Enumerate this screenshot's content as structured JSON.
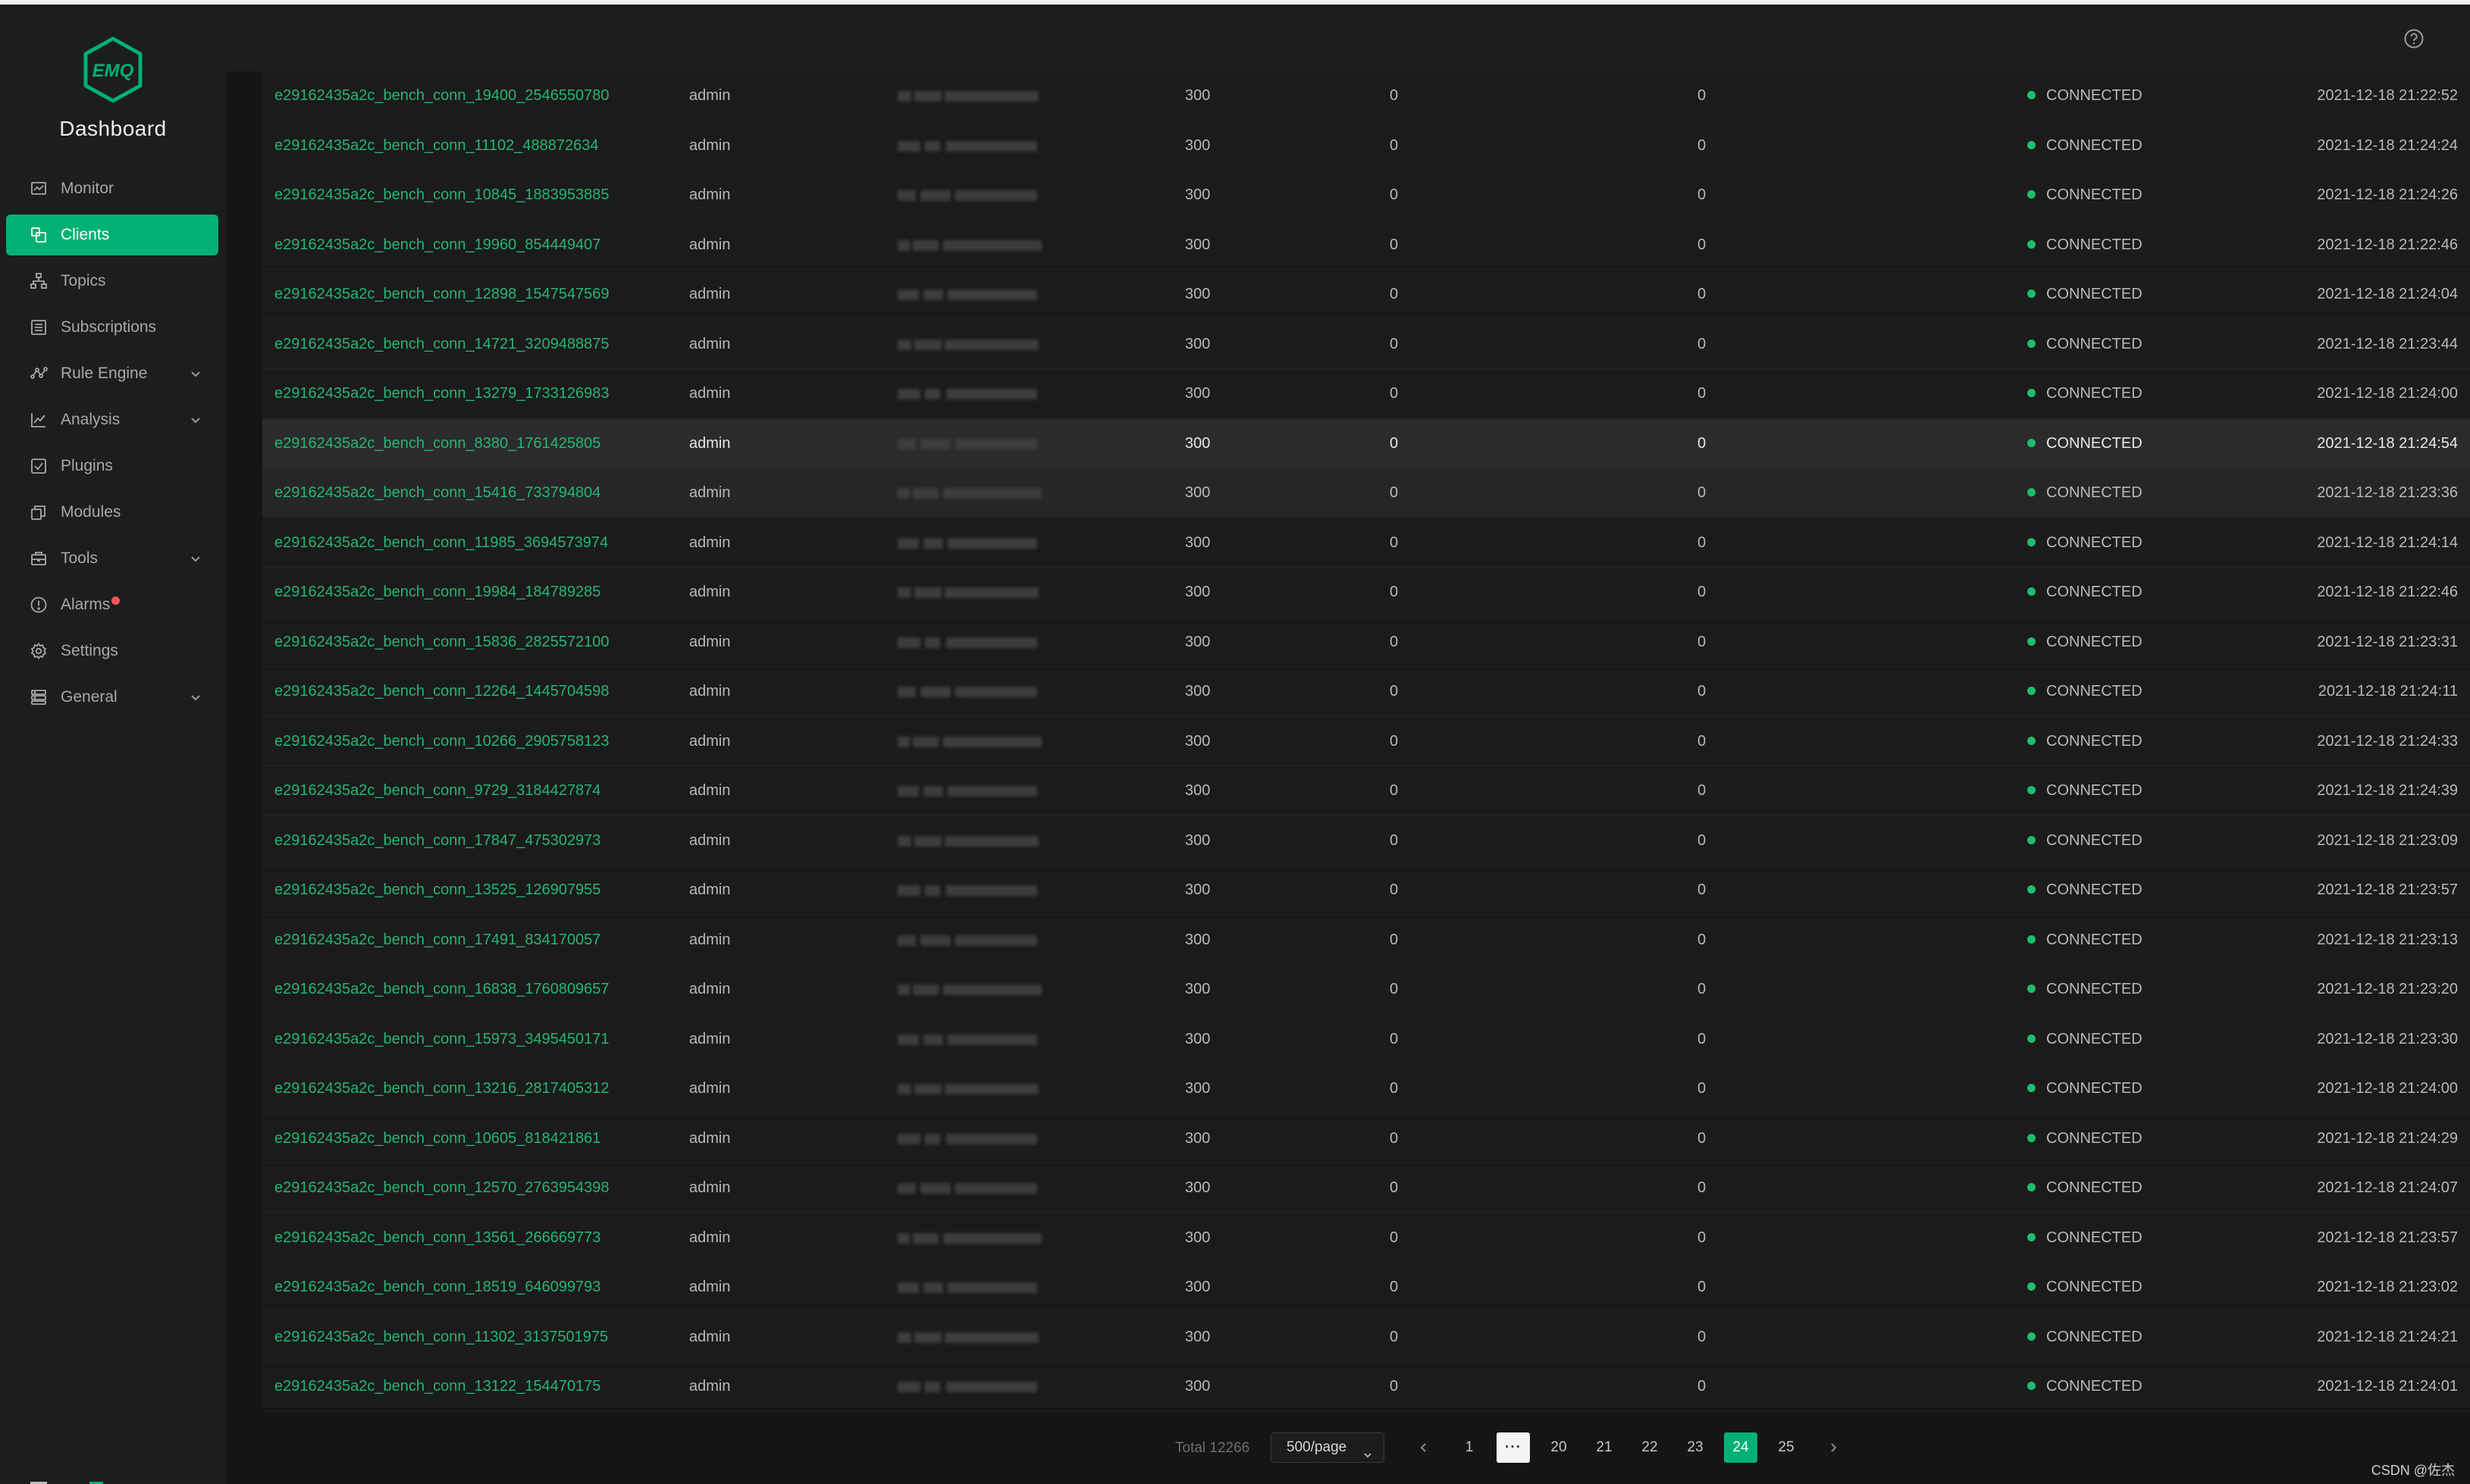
{
  "app": {
    "title": "Dashboard",
    "logo_text": "EMQ",
    "accent": "#00b173"
  },
  "sidebar": {
    "items": [
      {
        "key": "monitor",
        "label": "Monitor",
        "icon": "monitor-icon",
        "active": false,
        "expandable": false
      },
      {
        "key": "clients",
        "label": "Clients",
        "icon": "clients-icon",
        "active": true,
        "expandable": false
      },
      {
        "key": "topics",
        "label": "Topics",
        "icon": "topics-icon",
        "active": false,
        "expandable": false
      },
      {
        "key": "subscriptions",
        "label": "Subscriptions",
        "icon": "subscriptions-icon",
        "active": false,
        "expandable": false
      },
      {
        "key": "rule-engine",
        "label": "Rule Engine",
        "icon": "rule-engine-icon",
        "active": false,
        "expandable": true
      },
      {
        "key": "analysis",
        "label": "Analysis",
        "icon": "analysis-icon",
        "active": false,
        "expandable": true
      },
      {
        "key": "plugins",
        "label": "Plugins",
        "icon": "plugins-icon",
        "active": false,
        "expandable": false
      },
      {
        "key": "modules",
        "label": "Modules",
        "icon": "modules-icon",
        "active": false,
        "expandable": false
      },
      {
        "key": "tools",
        "label": "Tools",
        "icon": "tools-icon",
        "active": false,
        "expandable": true
      },
      {
        "key": "alarms",
        "label": "Alarms",
        "icon": "alarms-icon",
        "active": false,
        "expandable": false,
        "badge_dot": true
      },
      {
        "key": "settings",
        "label": "Settings",
        "icon": "settings-icon",
        "active": false,
        "expandable": false
      },
      {
        "key": "general",
        "label": "General",
        "icon": "general-icon",
        "active": false,
        "expandable": true
      }
    ]
  },
  "header": {
    "help_icon": "help-icon"
  },
  "table": {
    "status_color": "#1fbc6d",
    "rows": [
      {
        "client_id": "e29162435a2c_bench_conn_19400_2546550780",
        "username": "admin",
        "keepalive": "300",
        "q1": "0",
        "q2": "0",
        "status": "CONNECTED",
        "time": "2021-12-18 21:22:52"
      },
      {
        "client_id": "e29162435a2c_bench_conn_11102_488872634",
        "username": "admin",
        "keepalive": "300",
        "q1": "0",
        "q2": "0",
        "status": "CONNECTED",
        "time": "2021-12-18 21:24:24"
      },
      {
        "client_id": "e29162435a2c_bench_conn_10845_1883953885",
        "username": "admin",
        "keepalive": "300",
        "q1": "0",
        "q2": "0",
        "status": "CONNECTED",
        "time": "2021-12-18 21:24:26"
      },
      {
        "client_id": "e29162435a2c_bench_conn_19960_854449407",
        "username": "admin",
        "keepalive": "300",
        "q1": "0",
        "q2": "0",
        "status": "CONNECTED",
        "time": "2021-12-18 21:22:46"
      },
      {
        "client_id": "e29162435a2c_bench_conn_12898_1547547569",
        "username": "admin",
        "keepalive": "300",
        "q1": "0",
        "q2": "0",
        "status": "CONNECTED",
        "time": "2021-12-18 21:24:04"
      },
      {
        "client_id": "e29162435a2c_bench_conn_14721_3209488875",
        "username": "admin",
        "keepalive": "300",
        "q1": "0",
        "q2": "0",
        "status": "CONNECTED",
        "time": "2021-12-18 21:23:44"
      },
      {
        "client_id": "e29162435a2c_bench_conn_13279_1733126983",
        "username": "admin",
        "keepalive": "300",
        "q1": "0",
        "q2": "0",
        "status": "CONNECTED",
        "time": "2021-12-18 21:24:00"
      },
      {
        "client_id": "e29162435a2c_bench_conn_8380_1761425805",
        "username": "admin",
        "keepalive": "300",
        "q1": "0",
        "q2": "0",
        "status": "CONNECTED",
        "time": "2021-12-18 21:24:54"
      },
      {
        "client_id": "e29162435a2c_bench_conn_15416_733794804",
        "username": "admin",
        "keepalive": "300",
        "q1": "0",
        "q2": "0",
        "status": "CONNECTED",
        "time": "2021-12-18 21:23:36"
      },
      {
        "client_id": "e29162435a2c_bench_conn_11985_3694573974",
        "username": "admin",
        "keepalive": "300",
        "q1": "0",
        "q2": "0",
        "status": "CONNECTED",
        "time": "2021-12-18 21:24:14"
      },
      {
        "client_id": "e29162435a2c_bench_conn_19984_184789285",
        "username": "admin",
        "keepalive": "300",
        "q1": "0",
        "q2": "0",
        "status": "CONNECTED",
        "time": "2021-12-18 21:22:46"
      },
      {
        "client_id": "e29162435a2c_bench_conn_15836_2825572100",
        "username": "admin",
        "keepalive": "300",
        "q1": "0",
        "q2": "0",
        "status": "CONNECTED",
        "time": "2021-12-18 21:23:31"
      },
      {
        "client_id": "e29162435a2c_bench_conn_12264_1445704598",
        "username": "admin",
        "keepalive": "300",
        "q1": "0",
        "q2": "0",
        "status": "CONNECTED",
        "time": "2021-12-18 21:24:11"
      },
      {
        "client_id": "e29162435a2c_bench_conn_10266_2905758123",
        "username": "admin",
        "keepalive": "300",
        "q1": "0",
        "q2": "0",
        "status": "CONNECTED",
        "time": "2021-12-18 21:24:33"
      },
      {
        "client_id": "e29162435a2c_bench_conn_9729_3184427874",
        "username": "admin",
        "keepalive": "300",
        "q1": "0",
        "q2": "0",
        "status": "CONNECTED",
        "time": "2021-12-18 21:24:39"
      },
      {
        "client_id": "e29162435a2c_bench_conn_17847_475302973",
        "username": "admin",
        "keepalive": "300",
        "q1": "0",
        "q2": "0",
        "status": "CONNECTED",
        "time": "2021-12-18 21:23:09"
      },
      {
        "client_id": "e29162435a2c_bench_conn_13525_126907955",
        "username": "admin",
        "keepalive": "300",
        "q1": "0",
        "q2": "0",
        "status": "CONNECTED",
        "time": "2021-12-18 21:23:57"
      },
      {
        "client_id": "e29162435a2c_bench_conn_17491_834170057",
        "username": "admin",
        "keepalive": "300",
        "q1": "0",
        "q2": "0",
        "status": "CONNECTED",
        "time": "2021-12-18 21:23:13"
      },
      {
        "client_id": "e29162435a2c_bench_conn_16838_1760809657",
        "username": "admin",
        "keepalive": "300",
        "q1": "0",
        "q2": "0",
        "status": "CONNECTED",
        "time": "2021-12-18 21:23:20"
      },
      {
        "client_id": "e29162435a2c_bench_conn_15973_3495450171",
        "username": "admin",
        "keepalive": "300",
        "q1": "0",
        "q2": "0",
        "status": "CONNECTED",
        "time": "2021-12-18 21:23:30"
      },
      {
        "client_id": "e29162435a2c_bench_conn_13216_2817405312",
        "username": "admin",
        "keepalive": "300",
        "q1": "0",
        "q2": "0",
        "status": "CONNECTED",
        "time": "2021-12-18 21:24:00"
      },
      {
        "client_id": "e29162435a2c_bench_conn_10605_818421861",
        "username": "admin",
        "keepalive": "300",
        "q1": "0",
        "q2": "0",
        "status": "CONNECTED",
        "time": "2021-12-18 21:24:29"
      },
      {
        "client_id": "e29162435a2c_bench_conn_12570_2763954398",
        "username": "admin",
        "keepalive": "300",
        "q1": "0",
        "q2": "0",
        "status": "CONNECTED",
        "time": "2021-12-18 21:24:07"
      },
      {
        "client_id": "e29162435a2c_bench_conn_13561_266669773",
        "username": "admin",
        "keepalive": "300",
        "q1": "0",
        "q2": "0",
        "status": "CONNECTED",
        "time": "2021-12-18 21:23:57"
      },
      {
        "client_id": "e29162435a2c_bench_conn_18519_646099793",
        "username": "admin",
        "keepalive": "300",
        "q1": "0",
        "q2": "0",
        "status": "CONNECTED",
        "time": "2021-12-18 21:23:02"
      },
      {
        "client_id": "e29162435a2c_bench_conn_11302_3137501975",
        "username": "admin",
        "keepalive": "300",
        "q1": "0",
        "q2": "0",
        "status": "CONNECTED",
        "time": "2021-12-18 21:24:21"
      },
      {
        "client_id": "e29162435a2c_bench_conn_13122_154470175",
        "username": "admin",
        "keepalive": "300",
        "q1": "0",
        "q2": "0",
        "status": "CONNECTED",
        "time": "2021-12-18 21:24:01"
      }
    ]
  },
  "pagination": {
    "total": "Total 12266",
    "page_size": "500/page",
    "pages": [
      "1",
      "···",
      "20",
      "21",
      "22",
      "23",
      "24",
      "25"
    ],
    "current": "24"
  },
  "watermark": "CSDN @佐杰"
}
